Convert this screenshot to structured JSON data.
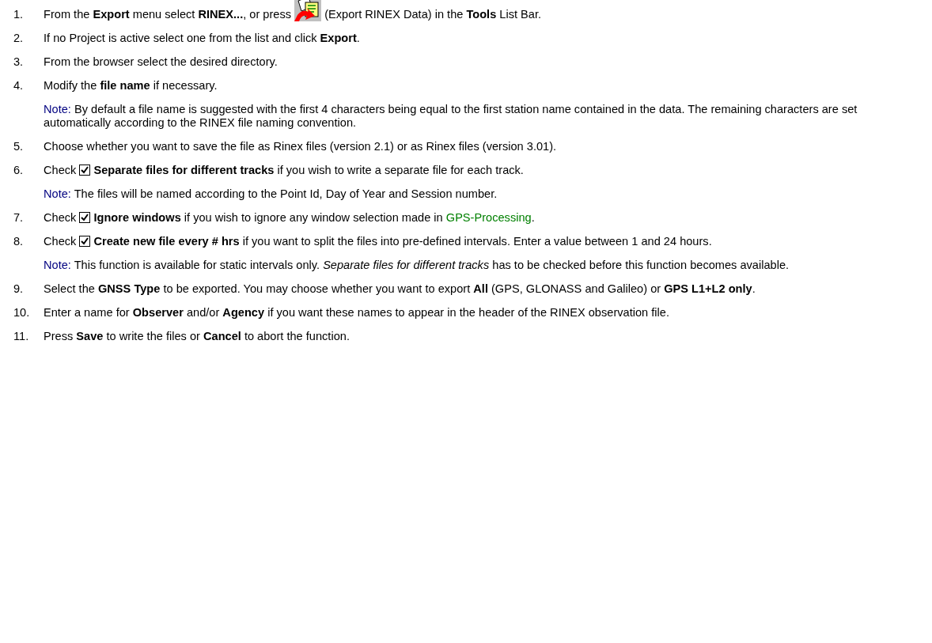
{
  "steps": [
    {
      "number": "1.",
      "segments": [
        {
          "kind": "text",
          "text": "From the **Export** menu select **RINEX...**, or press "
        },
        {
          "kind": "icon"
        },
        {
          "kind": "text",
          "text": " (Export RINEX Data) in the **Tools** List Bar."
        }
      ]
    },
    {
      "number": "2.",
      "segments": [
        {
          "kind": "text",
          "text": "If no Project is active select one from the list and click **Export**."
        }
      ]
    },
    {
      "number": "3.",
      "segments": [
        {
          "kind": "text",
          "text": "From the browser select the desired directory."
        }
      ]
    },
    {
      "number": "4.",
      "segments": [
        {
          "kind": "text",
          "text": "Modify the **file name** if necessary."
        }
      ],
      "note": {
        "label": "Note:",
        "text": " By default a file name is suggested with the first 4 characters being equal to the first station name contained in the data. The remaining characters are set automatically according to the RINEX file naming convention."
      }
    },
    {
      "number": "5.",
      "segments": [
        {
          "kind": "text",
          "text": "Choose whether you want to save the file as Rinex files (version 2.1) or as Rinex files (version 3.01)."
        }
      ]
    },
    {
      "number": "6.",
      "segments": [
        {
          "kind": "text",
          "text": "Check "
        },
        {
          "kind": "checkbox",
          "checked": true
        },
        {
          "kind": "text",
          "text": " **Separate files for different tracks** if you wish to write a separate file for each track."
        }
      ],
      "note": {
        "label": "Note:",
        "text": " The files will be named according to the Point Id, Day of Year and Session number."
      }
    },
    {
      "number": "7.",
      "segments": [
        {
          "kind": "text",
          "text": "Check "
        },
        {
          "kind": "checkbox",
          "checked": true
        },
        {
          "kind": "text",
          "text": " **Ignore windows** if you wish to ignore any window selection made in "
        },
        {
          "kind": "link",
          "text": "GPS-Processing"
        },
        {
          "kind": "text",
          "text": "."
        }
      ]
    },
    {
      "number": "8.",
      "segments": [
        {
          "kind": "text",
          "text": "Check "
        },
        {
          "kind": "checkbox",
          "checked": true
        },
        {
          "kind": "text",
          "text": " **Create new file every # hrs** if you want to split the files into pre-defined intervals. Enter a value between 1 and 24 hours."
        }
      ],
      "note": {
        "label": "Note:",
        "text": " This function is available for static intervals only. *Separate files for different tracks* has to be checked before this function becomes available."
      }
    },
    {
      "number": "9.",
      "segments": [
        {
          "kind": "text",
          "text": "Select the **GNSS Type** to be exported. You may choose whether you want to export **All** (GPS, GLONASS and Galileo) or **GPS L1+L2 only**."
        }
      ]
    },
    {
      "number": "10.",
      "segments": [
        {
          "kind": "text",
          "text": "Enter a name for **Observer** and/or **Agency** if you want these names to appear in the header of the RINEX observation file."
        }
      ]
    },
    {
      "number": "11.",
      "segments": [
        {
          "kind": "text",
          "text": "Press **Save** to write the files or **Cancel** to abort the function."
        }
      ]
    }
  ]
}
